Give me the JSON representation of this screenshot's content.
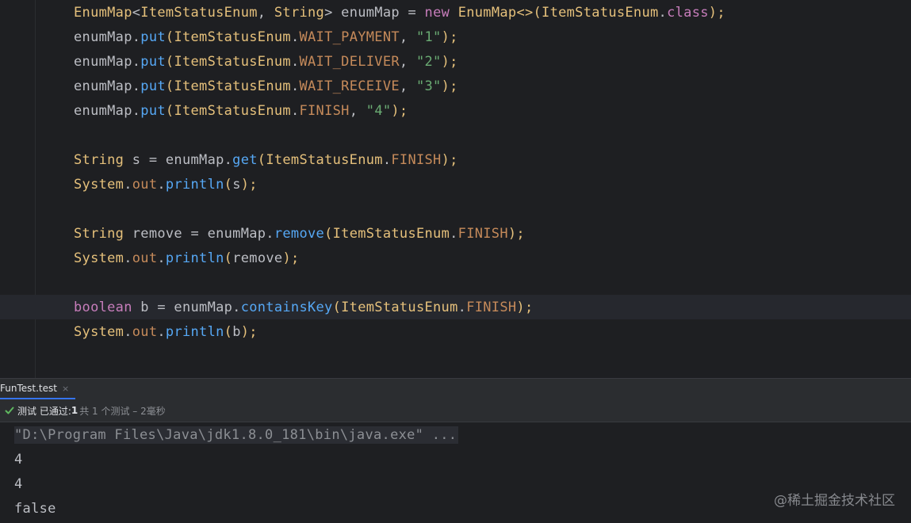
{
  "editor": {
    "lines": [
      [
        {
          "t": "EnumMap",
          "c": "type"
        },
        {
          "t": "<",
          "c": "pl"
        },
        {
          "t": "ItemStatusEnum",
          "c": "type"
        },
        {
          "t": ", ",
          "c": "pl"
        },
        {
          "t": "String",
          "c": "type"
        },
        {
          "t": "> ",
          "c": "pl"
        },
        {
          "t": "enumMap",
          "c": "pl"
        },
        {
          "t": " = ",
          "c": "pl"
        },
        {
          "t": "new",
          "c": "kw2"
        },
        {
          "t": " ",
          "c": "pl"
        },
        {
          "t": "EnumMap",
          "c": "type"
        },
        {
          "t": "<>(",
          "c": "br"
        },
        {
          "t": "ItemStatusEnum",
          "c": "type"
        },
        {
          "t": ".",
          "c": "pl"
        },
        {
          "t": "class",
          "c": "kw2"
        },
        {
          "t": ");",
          "c": "br"
        }
      ],
      [
        {
          "t": "enumMap.",
          "c": "pl"
        },
        {
          "t": "put",
          "c": "meth"
        },
        {
          "t": "(",
          "c": "br"
        },
        {
          "t": "ItemStatusEnum",
          "c": "type"
        },
        {
          "t": ".",
          "c": "pl"
        },
        {
          "t": "WAIT_PAYMENT",
          "c": "cst"
        },
        {
          "t": ", ",
          "c": "pl"
        },
        {
          "t": "\"1\"",
          "c": "str"
        },
        {
          "t": ");",
          "c": "br"
        }
      ],
      [
        {
          "t": "enumMap.",
          "c": "pl"
        },
        {
          "t": "put",
          "c": "meth"
        },
        {
          "t": "(",
          "c": "br"
        },
        {
          "t": "ItemStatusEnum",
          "c": "type"
        },
        {
          "t": ".",
          "c": "pl"
        },
        {
          "t": "WAIT_DELIVER",
          "c": "cst"
        },
        {
          "t": ", ",
          "c": "pl"
        },
        {
          "t": "\"2\"",
          "c": "str"
        },
        {
          "t": ");",
          "c": "br"
        }
      ],
      [
        {
          "t": "enumMap.",
          "c": "pl"
        },
        {
          "t": "put",
          "c": "meth"
        },
        {
          "t": "(",
          "c": "br"
        },
        {
          "t": "ItemStatusEnum",
          "c": "type"
        },
        {
          "t": ".",
          "c": "pl"
        },
        {
          "t": "WAIT_RECEIVE",
          "c": "cst"
        },
        {
          "t": ", ",
          "c": "pl"
        },
        {
          "t": "\"3\"",
          "c": "str"
        },
        {
          "t": ");",
          "c": "br"
        }
      ],
      [
        {
          "t": "enumMap.",
          "c": "pl"
        },
        {
          "t": "put",
          "c": "meth"
        },
        {
          "t": "(",
          "c": "br"
        },
        {
          "t": "ItemStatusEnum",
          "c": "type"
        },
        {
          "t": ".",
          "c": "pl"
        },
        {
          "t": "FINISH",
          "c": "cst"
        },
        {
          "t": ", ",
          "c": "pl"
        },
        {
          "t": "\"4\"",
          "c": "str"
        },
        {
          "t": ");",
          "c": "br"
        }
      ],
      [],
      [
        {
          "t": "String",
          "c": "type"
        },
        {
          "t": " s = enumMap.",
          "c": "pl"
        },
        {
          "t": "get",
          "c": "meth"
        },
        {
          "t": "(",
          "c": "br"
        },
        {
          "t": "ItemStatusEnum",
          "c": "type"
        },
        {
          "t": ".",
          "c": "pl"
        },
        {
          "t": "FINISH",
          "c": "cst"
        },
        {
          "t": ");",
          "c": "br"
        }
      ],
      [
        {
          "t": "System",
          "c": "type"
        },
        {
          "t": ".",
          "c": "pl"
        },
        {
          "t": "out",
          "c": "cst"
        },
        {
          "t": ".",
          "c": "pl"
        },
        {
          "t": "println",
          "c": "meth"
        },
        {
          "t": "(",
          "c": "br"
        },
        {
          "t": "s",
          "c": "pl"
        },
        {
          "t": ");",
          "c": "br"
        }
      ],
      [],
      [
        {
          "t": "String",
          "c": "type"
        },
        {
          "t": " remove = enumMap.",
          "c": "pl"
        },
        {
          "t": "remove",
          "c": "meth"
        },
        {
          "t": "(",
          "c": "br"
        },
        {
          "t": "ItemStatusEnum",
          "c": "type"
        },
        {
          "t": ".",
          "c": "pl"
        },
        {
          "t": "FINISH",
          "c": "cst"
        },
        {
          "t": ");",
          "c": "br"
        }
      ],
      [
        {
          "t": "System",
          "c": "type"
        },
        {
          "t": ".",
          "c": "pl"
        },
        {
          "t": "out",
          "c": "cst"
        },
        {
          "t": ".",
          "c": "pl"
        },
        {
          "t": "println",
          "c": "meth"
        },
        {
          "t": "(",
          "c": "br"
        },
        {
          "t": "remove",
          "c": "pl"
        },
        {
          "t": ");",
          "c": "br"
        }
      ],
      [],
      [
        {
          "t": "boolean",
          "c": "kw2"
        },
        {
          "t": " b = enumMap.",
          "c": "pl"
        },
        {
          "t": "containsKey",
          "c": "meth"
        },
        {
          "t": "(",
          "c": "br"
        },
        {
          "t": "ItemStatusEnum",
          "c": "type"
        },
        {
          "t": ".",
          "c": "pl"
        },
        {
          "t": "FINISH",
          "c": "cst"
        },
        {
          "t": ");",
          "c": "br"
        }
      ],
      [
        {
          "t": "System",
          "c": "type"
        },
        {
          "t": ".",
          "c": "pl"
        },
        {
          "t": "out",
          "c": "cst"
        },
        {
          "t": ".",
          "c": "pl"
        },
        {
          "t": "println",
          "c": "meth"
        },
        {
          "t": "(",
          "c": "br"
        },
        {
          "t": "b",
          "c": "pl"
        },
        {
          "t": ");",
          "c": "br"
        }
      ]
    ]
  },
  "run_panel": {
    "tab_label": "FunTest.test",
    "tab_close": "×",
    "status_prefix": "测试 已通过: ",
    "status_count": "1",
    "status_rest": "共 1 个测试 – 2毫秒",
    "status_icon": "check-icon",
    "console_lines": [
      "\"D:\\Program Files\\Java\\jdk1.8.0_181\\bin\\java.exe\" ...",
      "4",
      "4",
      "false"
    ]
  },
  "watermark": "@稀土掘金技术社区",
  "colors": {
    "accent": "#3574f0",
    "pass": "#5fb85f"
  }
}
